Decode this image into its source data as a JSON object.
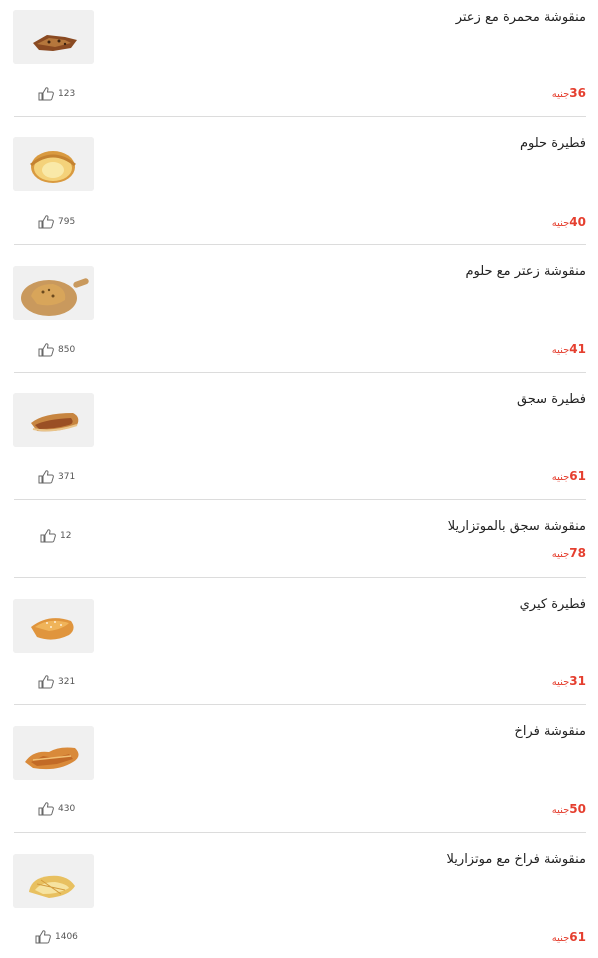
{
  "currency": "جنيه",
  "items": [
    {
      "name": "منقوشة محمرة مع زعتر",
      "price": "36",
      "likes": "123",
      "image": "flat-manakish-zaatar"
    },
    {
      "name": "فطيرة حلوم",
      "price": "40",
      "likes": "795",
      "image": "halloum-bun"
    },
    {
      "name": "منقوشة زعتر مع حلوم",
      "price": "41",
      "likes": "850",
      "image": "manakish-on-wooden-board"
    },
    {
      "name": "فطيرة سجق",
      "price": "61",
      "likes": "371",
      "image": "sausage-pastry"
    },
    {
      "name": "منقوشة سجق بالموتزاريلا",
      "price": "78",
      "likes": "12",
      "image": ""
    },
    {
      "name": "فطيرة كيري",
      "price": "31",
      "likes": "321",
      "image": "kiri-pastry"
    },
    {
      "name": "منقوشة فراخ",
      "price": "50",
      "likes": "430",
      "image": "chicken-manakish"
    },
    {
      "name": "منقوشة فراخ مع موتزاريلا",
      "price": "61",
      "likes": "1406",
      "image": "chicken-mozzarella-manakish"
    }
  ]
}
